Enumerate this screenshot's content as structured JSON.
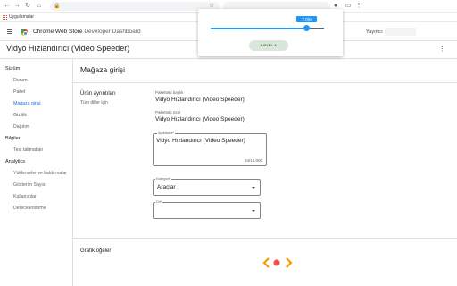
{
  "browser": {
    "bookmarks_label": "Uygulamalar"
  },
  "header": {
    "app_name_prefix": "Chrome Web Store",
    "app_name_suffix": "Developer Dashboard",
    "publisher_label": "Yayıncı:"
  },
  "item": {
    "title": "Vidyo Hızlandırıcı (Video Speeder)"
  },
  "sidebar": {
    "sections": [
      {
        "label": "Sürüm",
        "items": [
          "Durum",
          "Paket",
          "Mağaza girişi",
          "Gizlilik",
          "Dağıtım"
        ]
      },
      {
        "label": "Bilgiler",
        "items": [
          "Test talimatları"
        ]
      },
      {
        "label": "Analytics",
        "items": [
          "Yüklemeler ve kaldırmalar",
          "Gösterim Sayısı",
          "Kullanıcılar",
          "Derecelendirme"
        ]
      }
    ],
    "active_item": "Mağaza girişi"
  },
  "main": {
    "page_title": "Mağaza girişi",
    "section_title": "Ürün ayrıntıları",
    "section_subtitle": "Tüm diller için",
    "package_title_caption": "Paketteki başlık",
    "package_title_value": "Vidyo Hızlandırıcı (Video Speeder)",
    "package_summary_caption": "Paketteki özet",
    "package_summary_value": "Vidyo Hızlandırıcı (Video Speeder)",
    "description_caption": "Açıklama*",
    "description_value": "Vidyo Hızlandırıcı (Video Speeder)",
    "description_count": "34/16.000",
    "category_caption": "Kategori*",
    "category_value": "Araçlar",
    "language_caption": "Dil*",
    "language_value": "",
    "graphics_title": "Grafik öğeler"
  },
  "popup": {
    "speed_value": "7,00x",
    "slider_level": 0.85,
    "reset_label": "SIFIRLA"
  },
  "colors": {
    "accent": "#1a73e8",
    "slider": "#2196f3",
    "logo_orange": "#ff9800"
  }
}
